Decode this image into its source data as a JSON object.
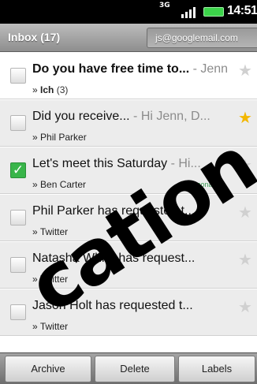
{
  "status_bar": {
    "network": "3G",
    "time": "14:51"
  },
  "header": {
    "folder": "Inbox (17)",
    "account": "js@googlemail.com"
  },
  "messages": [
    {
      "subject": "Do you have free time to...",
      "snippet": " - Jenn",
      "from_prefix": "»",
      "from": "Ich",
      "count": " (3)",
      "unread": true,
      "checked": false,
      "starred": false,
      "label": ""
    },
    {
      "subject": "Did you receive...",
      "snippet": " - Hi Jenn, D...",
      "from_prefix": "»",
      "from": "Phil Parker",
      "count": "",
      "unread": false,
      "checked": false,
      "starred": true,
      "label": ""
    },
    {
      "subject": "Let's meet this Saturday",
      "snippet": " - Hi...",
      "from_prefix": "»",
      "from": "Ben Carter",
      "count": "",
      "unread": false,
      "checked": true,
      "starred": false,
      "label": "Personal"
    },
    {
      "subject": "Phil Parker has requested t...",
      "snippet": "",
      "from_prefix": "»",
      "from": "Twitter",
      "count": "",
      "unread": false,
      "checked": false,
      "starred": false,
      "label": ""
    },
    {
      "subject": "Natasha White has request...",
      "snippet": "",
      "from_prefix": "»",
      "from": "Twitter",
      "count": "",
      "unread": false,
      "checked": false,
      "starred": false,
      "label": ""
    },
    {
      "subject": "Jason Holt has requested t...",
      "snippet": "",
      "from_prefix": "»",
      "from": "Twitter",
      "count": "",
      "unread": false,
      "checked": false,
      "starred": false,
      "label": ""
    }
  ],
  "actions": {
    "archive": "Archive",
    "delete": "Delete",
    "labels": "Labels"
  },
  "watermark": "cation",
  "icons": {
    "checkmark": "✓",
    "star": "★"
  },
  "colors": {
    "star_on": "#f3b700",
    "check_green": "#39b54a",
    "label_green": "#3a9a52"
  }
}
